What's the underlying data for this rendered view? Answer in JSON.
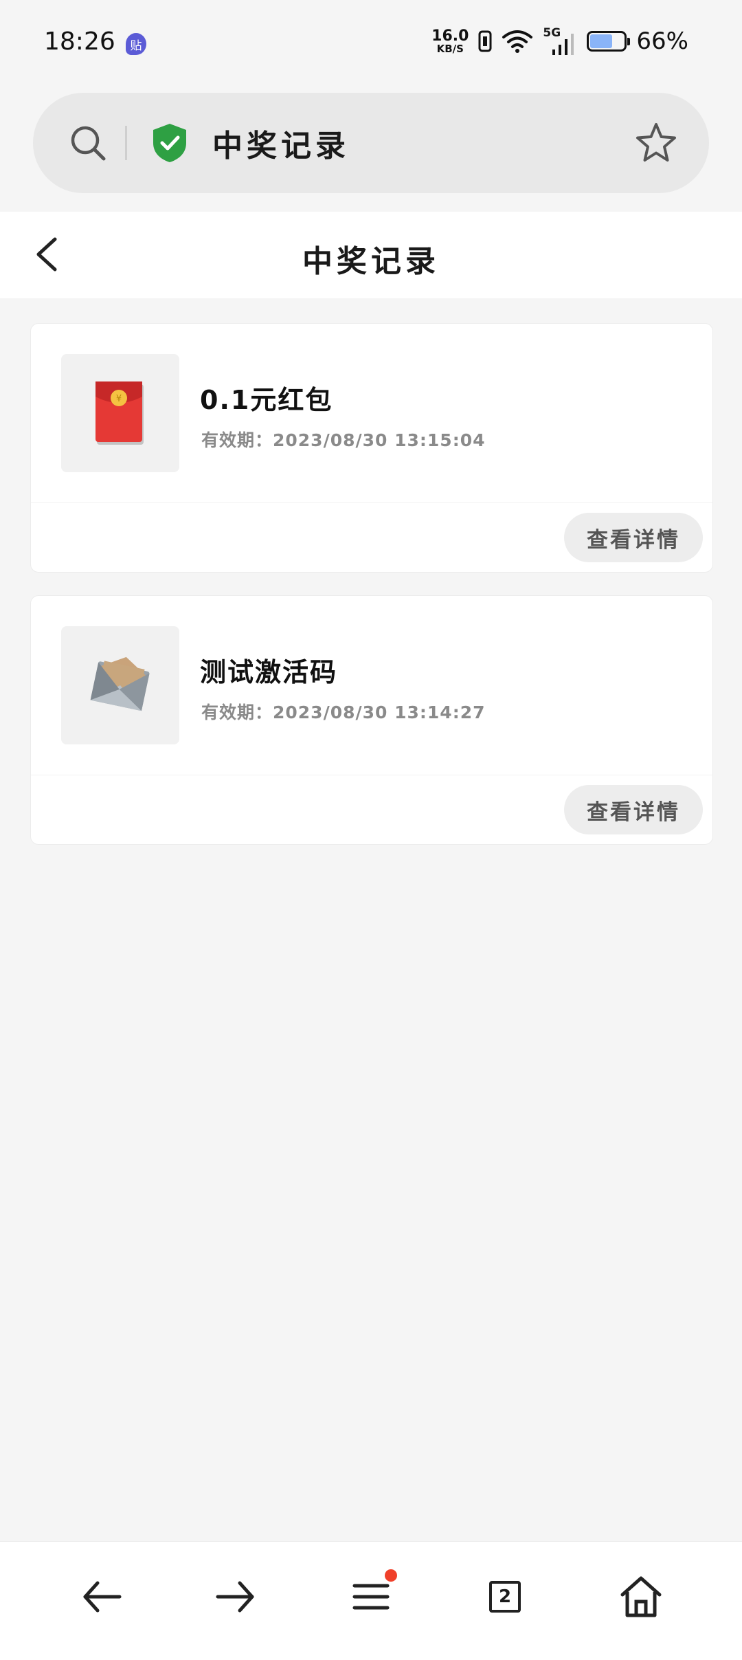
{
  "status_bar": {
    "time": "18:26",
    "notification_icon_text": "贴",
    "net_speed_value": "16.0",
    "net_speed_unit": "KB/S",
    "network_type": "5G",
    "battery_percent": "66%",
    "battery_level": 0.66
  },
  "address_bar": {
    "title": "中奖记录",
    "secure_color": "#2ea043"
  },
  "header": {
    "title": "中奖记录"
  },
  "records": [
    {
      "name": "0.1元红包",
      "expiry": "有效期：2023/08/30 13:15:04",
      "detail_label": "查看详情",
      "icon": "red-envelope-icon"
    },
    {
      "name": "测试激活码",
      "expiry": "有效期：2023/08/30 13:14:27",
      "detail_label": "查看详情",
      "icon": "envelope-icon"
    }
  ],
  "bottom_nav": {
    "tab_count": "2",
    "items": [
      "back-arrow-icon",
      "forward-arrow-icon",
      "menu-icon",
      "tabs-icon",
      "home-icon"
    ]
  }
}
